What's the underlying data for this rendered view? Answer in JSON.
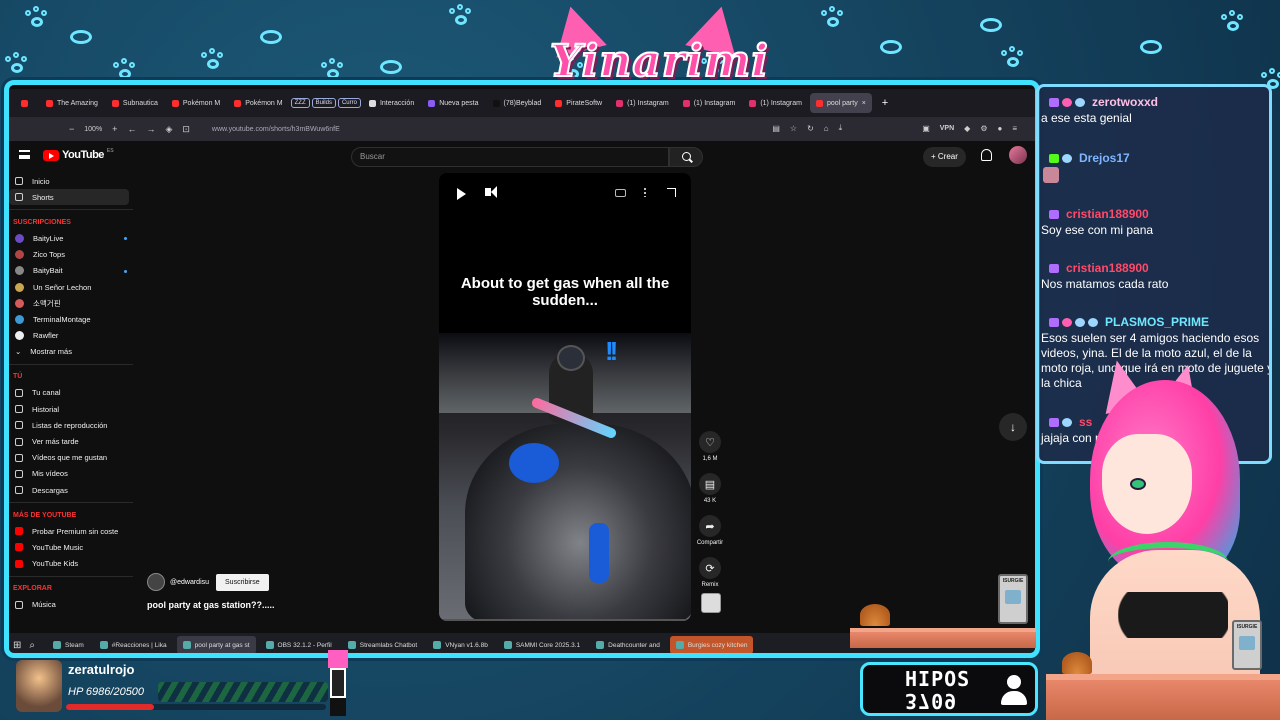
{
  "overlay": {
    "logo_text": "Yinarimi",
    "accent_color": "#3fe2ff",
    "brand_pink": "#ff4fa8"
  },
  "browser": {
    "tabs": [
      {
        "label": "",
        "icon": "youtube-icon"
      },
      {
        "label": "The Amazing",
        "icon": "youtube-icon"
      },
      {
        "label": "Subnautica",
        "icon": "youtube-icon"
      },
      {
        "label": "Pokémon M",
        "icon": "youtube-icon"
      },
      {
        "label": "Pokémon M",
        "icon": "youtube-icon"
      },
      {
        "label": "ZZZ",
        "icon": "badge"
      },
      {
        "label": "Builds",
        "icon": "badge"
      },
      {
        "label": "Curro",
        "icon": "badge"
      },
      {
        "label": "Interacción",
        "icon": "github-icon"
      },
      {
        "label": "Nueva pesta",
        "icon": "globe-icon"
      },
      {
        "label": "(78)Beyblad",
        "icon": "tiktok-icon"
      },
      {
        "label": "PirateSoftw",
        "icon": "youtube-icon"
      },
      {
        "label": "(1) Instagram",
        "icon": "instagram-icon"
      },
      {
        "label": "(1) Instagram",
        "icon": "instagram-icon"
      },
      {
        "label": "(1) Instagram",
        "icon": "instagram-icon"
      },
      {
        "label": "pool party",
        "icon": "youtube-icon",
        "active": true
      }
    ],
    "zoom": "100%",
    "url": "www.youtube.com/shorts/h3mBWuw6nfE",
    "vpn_label": "VPN"
  },
  "youtube": {
    "logo": "YouTube",
    "country_code": "ES",
    "search_placeholder": "Buscar",
    "create_label": "Crear",
    "sidebar": {
      "main": [
        {
          "label": "Inicio",
          "icon": "home-icon"
        },
        {
          "label": "Shorts",
          "icon": "shorts-icon",
          "active": true
        }
      ],
      "subscriptions_title": "SUSCRIPCIONES",
      "subscriptions": [
        {
          "label": "BaityLive",
          "dot": true,
          "color": "#6a4bc4"
        },
        {
          "label": "Zico Tops",
          "dot": false,
          "color": "#b04545"
        },
        {
          "label": "BaityBait",
          "dot": true,
          "color": "#888888"
        },
        {
          "label": "Un Señor Lechon",
          "dot": false,
          "color": "#c9a64f"
        },
        {
          "label": "소맥거핀",
          "dot": false,
          "color": "#d65a5a"
        },
        {
          "label": "TerminalMontage",
          "dot": false,
          "color": "#3c9ad6"
        },
        {
          "label": "Rawfler",
          "dot": false,
          "color": "#eeeeee"
        }
      ],
      "show_more": "Mostrar más",
      "you_title": "TÚ",
      "you": [
        {
          "label": "Tu canal",
          "icon": "user-icon"
        },
        {
          "label": "Historial",
          "icon": "history-icon"
        },
        {
          "label": "Listas de reproducción",
          "icon": "playlist-icon"
        },
        {
          "label": "Ver más tarde",
          "icon": "clock-icon"
        },
        {
          "label": "Vídeos que me gustan",
          "icon": "like-icon"
        },
        {
          "label": "Mis vídeos",
          "icon": "video-icon"
        },
        {
          "label": "Descargas",
          "icon": "download-icon"
        }
      ],
      "more_title": "MÁS DE YOUTUBE",
      "more": [
        {
          "label": "Probar Premium sin coste",
          "icon": "youtube-icon"
        },
        {
          "label": "YouTube Music",
          "icon": "music-icon"
        },
        {
          "label": "YouTube Kids",
          "icon": "kids-icon"
        }
      ],
      "explore_title": "EXPLORAR",
      "explore": [
        {
          "label": "Música",
          "icon": "music-icon"
        }
      ]
    },
    "short": {
      "caption": "About to get gas when all the sudden...",
      "likes": "1,6 M",
      "comments": "43 K",
      "share_label": "Compartir",
      "remix_label": "Remix",
      "channel": "@edwardisu",
      "subscribe_label": "Suscribirse",
      "title": "pool party at gas station??....."
    }
  },
  "taskbar": [
    {
      "label": "Steam",
      "active": false
    },
    {
      "label": "#Reacciones | Lika",
      "active": false
    },
    {
      "label": "pool party at gas st",
      "active": true
    },
    {
      "label": "OBS 32.1.2 - Perfil",
      "active": false
    },
    {
      "label": "Streamlabs Chatbot",
      "active": false
    },
    {
      "label": "VNyan v1.6.8b",
      "active": false
    },
    {
      "label": "SAMMI Core 2025.3.1",
      "active": false
    },
    {
      "label": "Deathcounter and",
      "active": false
    },
    {
      "label": "Burgies cozy kitchen",
      "active": false,
      "highlight": true
    }
  ],
  "chat": [
    {
      "user": "zerotwoxxd",
      "user_color": "pink",
      "badges": [
        "sub",
        "heart",
        "paw"
      ],
      "text": "a ese esta genial"
    },
    {
      "user": "Drejos17",
      "user_color": "blue",
      "badges": [
        "kick",
        "diamond"
      ],
      "text": ""
    },
    {
      "user": "cristian188900",
      "user_color": "red",
      "badges": [
        "sub"
      ],
      "text": "Soy ese con mi pana"
    },
    {
      "user": "cristian188900",
      "user_color": "red",
      "badges": [
        "sub"
      ],
      "text": "Nos matamos cada rato"
    },
    {
      "user": "PLASMOS_PRIME",
      "user_color": "cyan",
      "badges": [
        "sub",
        "heart",
        "paw",
        "gem"
      ],
      "text": "Esos suelen ser 4 amigos haciendo esos videos, yina. El de la moto azul, el de la moto roja, uno que irá en moto de juguete y la chica"
    },
    {
      "user": "ss",
      "user_color": "red",
      "badges": [
        "sub",
        "gem"
      ],
      "text": "jajaja con                     nas cosas asi y se e"
    }
  ],
  "viewer": {
    "name": "zeratulrojo",
    "hp_text": "HP 6986/20500",
    "hp_fraction": 0.34
  },
  "hipos": {
    "label": "HIPOS",
    "count": "3709"
  },
  "props": {
    "tv_label": "ISURGIE"
  }
}
